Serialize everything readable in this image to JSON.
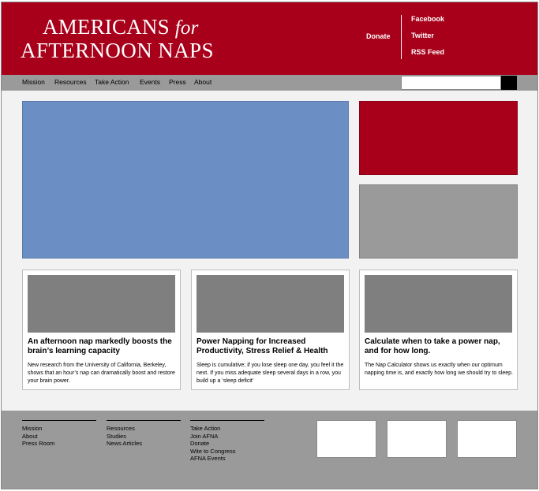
{
  "header": {
    "logo_line1": "AMERICANS",
    "logo_for": "for",
    "logo_line2": "AFTERNOON NAPS",
    "donate": "Donate",
    "social": [
      "Facebook",
      "Twitter",
      "RSS Feed"
    ]
  },
  "nav": {
    "items": [
      "Mission",
      "Resources",
      "Take Action",
      "Events",
      "Press",
      "About"
    ],
    "search_placeholder": ""
  },
  "colors": {
    "brand_red": "#a8001a",
    "hero_blue": "#6b8fc5",
    "gray": "#9a9a9a"
  },
  "cards": [
    {
      "title": "An afternoon nap markedly boosts the brain’s learning capacity",
      "text": "New research from the University of California, Berkeley, shows that an hour’s nap can dramatically boost and restore your brain power."
    },
    {
      "title": "Power Napping for Increased Productivity, Stress Relief & Health",
      "text": "Sleep is cumulative; if you lose sleep one day, you feel it the next. If you miss adequate sleep several days in a row, you build up a ‘sleep deficit’"
    },
    {
      "title": "Calculate when to take a power nap, and for how long.",
      "text": "The Nap Calculator shows us exactly when our optimum napping time is, and exactly how long we should try to sleep."
    }
  ],
  "footer": {
    "col1": [
      "Mission",
      "About",
      "Press Room"
    ],
    "col2": [
      "Resources",
      "Studies",
      "News Articles"
    ],
    "col3": [
      "Take Action",
      "Join AFNA",
      "Donate",
      "Wite to Congress",
      "AFNA Events"
    ]
  }
}
